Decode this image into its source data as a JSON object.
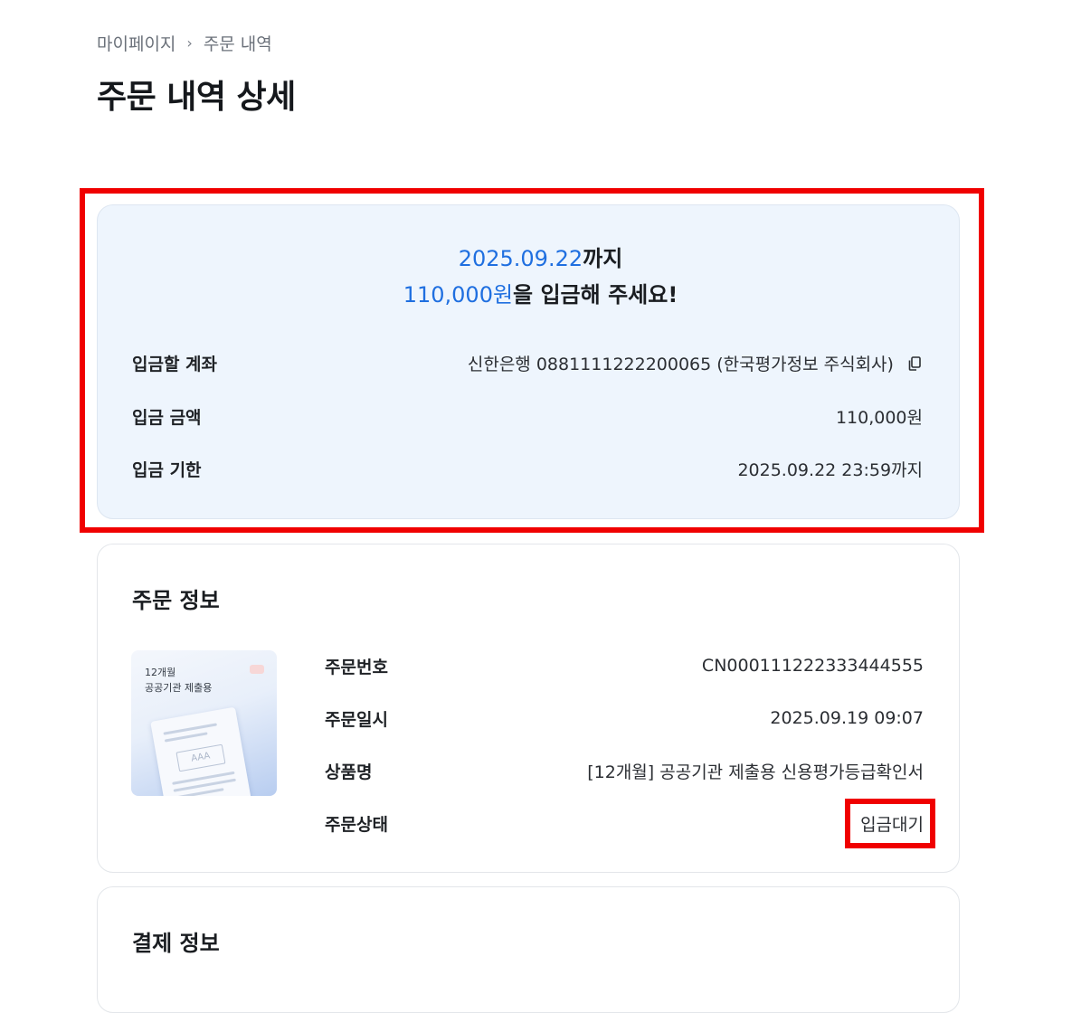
{
  "breadcrumb": {
    "items": [
      "마이페이지",
      "주문 내역"
    ]
  },
  "page_title": "주문 내역 상세",
  "deposit": {
    "deadline_date": "2025.09.22",
    "deadline_suffix": "까지",
    "amount_highlight": "110,000원",
    "amount_suffix": "을 입금해 주세요!",
    "rows": [
      {
        "label": "입금할 계좌",
        "value": "신한은행 0881111222200065 (한국평가정보 주식회사)"
      },
      {
        "label": "입금 금액",
        "value": "110,000원"
      },
      {
        "label": "입금 기한",
        "value": "2025.09.22 23:59까지"
      }
    ]
  },
  "order_info": {
    "title": "주문 정보",
    "thumbnail": {
      "line1": "12개월",
      "line2": "공공기관 제출용",
      "doc_text": "AAA"
    },
    "rows": [
      {
        "label": "주문번호",
        "value": "CN000111222333444555"
      },
      {
        "label": "주문일시",
        "value": "2025.09.19 09:07"
      },
      {
        "label": "상품명",
        "value": "[12개월] 공공기관 제출용 신용평가등급확인서"
      },
      {
        "label": "주문상태",
        "value": "입금대기"
      }
    ]
  },
  "payment_info": {
    "title": "결제 정보"
  },
  "icons": {
    "copy": "copy-icon",
    "breadcrumb_separator": "chevron-right-icon"
  },
  "colors": {
    "accent": "#1f6fe0",
    "highlight": "#f00000",
    "deposit_bg": "#eef5fd"
  }
}
